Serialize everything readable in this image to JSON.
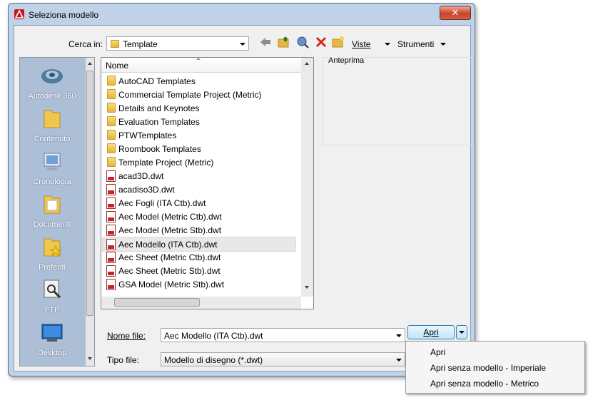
{
  "window": {
    "title": "Seleziona modello",
    "close_label": "✕"
  },
  "toolbar": {
    "look_in_label": "Cerca in:",
    "look_in_value": "Template",
    "views_label": "Viste",
    "tools_label": "Strumenti"
  },
  "places": [
    {
      "label": "Autodesk 360",
      "icon": "cloud-icon"
    },
    {
      "label": "Contenuto",
      "icon": "folder-icon"
    },
    {
      "label": "Cronologia",
      "icon": "history-icon"
    },
    {
      "label": "Documenti",
      "icon": "documents-icon"
    },
    {
      "label": "Preferiti",
      "icon": "favorites-icon"
    },
    {
      "label": "FTP",
      "icon": "ftp-icon"
    },
    {
      "label": "Desktop",
      "icon": "desktop-icon"
    }
  ],
  "filelist": {
    "column_name": "Nome",
    "items": [
      {
        "name": "AutoCAD Templates",
        "type": "folder"
      },
      {
        "name": "Commercial Template Project (Metric)",
        "type": "folder"
      },
      {
        "name": "Details and Keynotes",
        "type": "folder"
      },
      {
        "name": "Evaluation Templates",
        "type": "folder"
      },
      {
        "name": "PTWTemplates",
        "type": "folder"
      },
      {
        "name": "Roombook Templates",
        "type": "folder"
      },
      {
        "name": "Template Project (Metric)",
        "type": "folder"
      },
      {
        "name": "acad3D.dwt",
        "type": "dwt"
      },
      {
        "name": "acadiso3D.dwt",
        "type": "dwt"
      },
      {
        "name": "Aec Fogli (ITA Ctb).dwt",
        "type": "dwt"
      },
      {
        "name": "Aec Model (Metric Ctb).dwt",
        "type": "dwt"
      },
      {
        "name": "Aec Model (Metric Stb).dwt",
        "type": "dwt"
      },
      {
        "name": "Aec Modello (ITA Ctb).dwt",
        "type": "dwt",
        "selected": true
      },
      {
        "name": "Aec Sheet (Metric Ctb).dwt",
        "type": "dwt"
      },
      {
        "name": "Aec Sheet (Metric Stb).dwt",
        "type": "dwt"
      },
      {
        "name": "GSA Model (Metric Stb).dwt",
        "type": "dwt"
      }
    ]
  },
  "preview": {
    "label": "Anteprima"
  },
  "filename": {
    "label": "Nome file:",
    "value": "Aec Modello (ITA Ctb).dwt"
  },
  "filetype": {
    "label": "Tipo file:",
    "value": "Modello di disegno (*.dwt)"
  },
  "open_button": {
    "label": "Apri"
  },
  "open_menu": [
    {
      "label": "Apri"
    },
    {
      "label": "Apri senza modello - Imperiale"
    },
    {
      "label": "Apri senza modello - Metrico"
    }
  ]
}
